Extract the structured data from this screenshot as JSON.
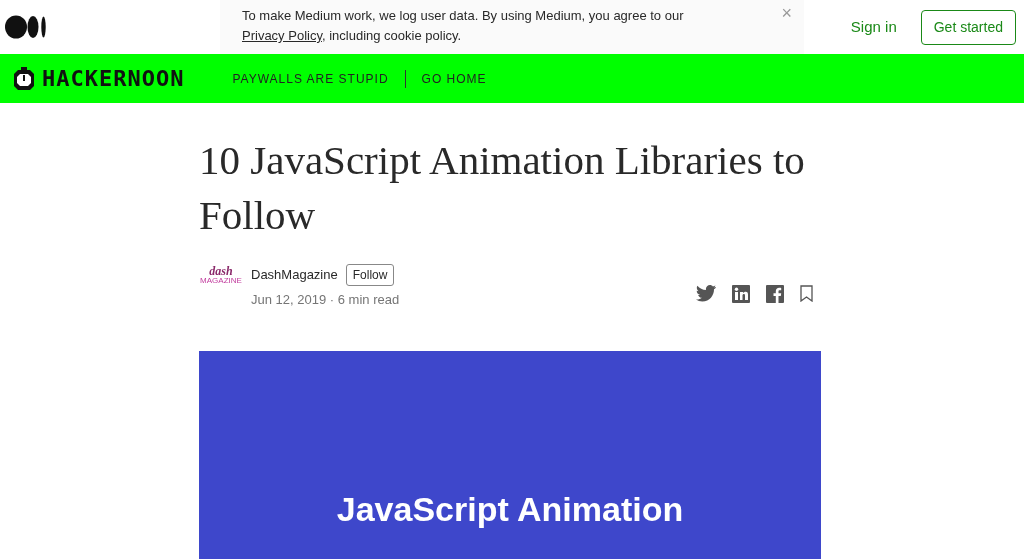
{
  "cookie_banner": {
    "text": "To make Medium work, we log user data. By using Medium, you agree to our ",
    "link": "Privacy Policy",
    "text_after": ", including cookie policy.",
    "close": "×"
  },
  "header": {
    "sign_in": "Sign in",
    "get_started": "Get started"
  },
  "publication_bar": {
    "logo": "HACKERNOON",
    "links": [
      "PAYWALLS ARE STUPID",
      "GO HOME"
    ]
  },
  "article": {
    "title": "10 JavaScript Animation Libraries to Follow",
    "author": {
      "avatar_top": "dash",
      "avatar_bottom": "MAGAZINE",
      "name": "DashMagazine",
      "follow": "Follow",
      "meta": "Jun 12, 2019 · 6 min read"
    },
    "hero_image": {
      "text": "JavaScript Animation"
    }
  }
}
